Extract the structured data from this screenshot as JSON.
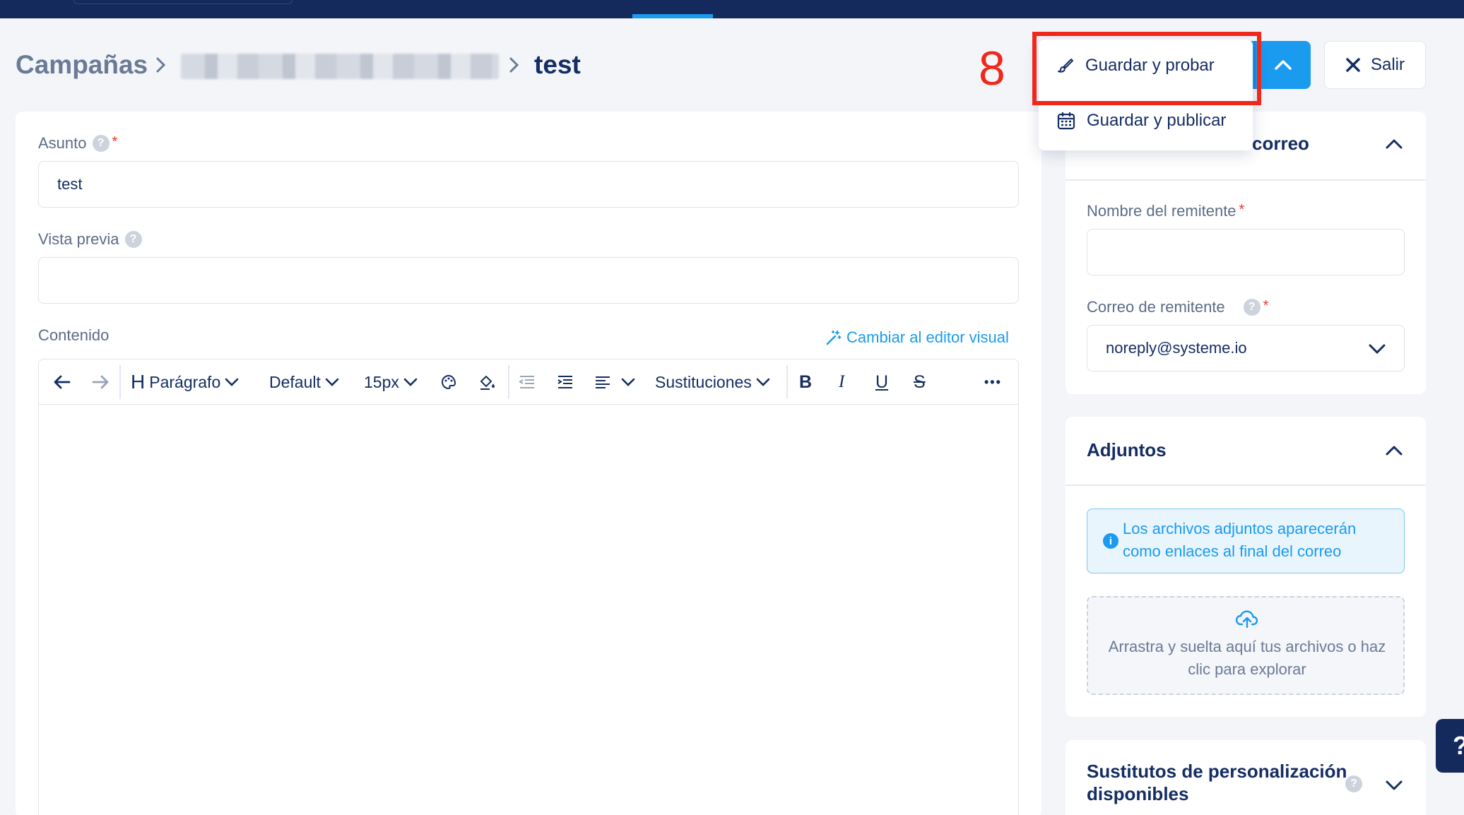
{
  "colors": {
    "accent": "#1a9bf0",
    "navy": "#14295c",
    "highlight": "#f0281c"
  },
  "breadcrumb": {
    "root": "Campañas",
    "separator": ">",
    "current": "test"
  },
  "annotation": {
    "step_number": "8"
  },
  "header": {
    "menu": {
      "save_test_label": "Guardar y probar",
      "save_publish_label": "Guardar y publicar"
    },
    "exit_label": "Salir"
  },
  "form": {
    "subject": {
      "label": "Asunto",
      "required_mark": "*",
      "value": "test"
    },
    "preview": {
      "label": "Vista previa",
      "value": ""
    },
    "content": {
      "label": "Contenido",
      "visual_editor_link": "Cambiar al editor visual"
    }
  },
  "toolbar": {
    "heading_glyph": "H",
    "paragraph": "Parágrafo",
    "font": "Default",
    "size": "15px",
    "bold": "B",
    "italic": "I",
    "underline": "U",
    "strike": "S",
    "substitutions": "Sustituciones",
    "more": "•••"
  },
  "sidebar": {
    "email_settings": {
      "title_suffix": "correo",
      "sender_name": {
        "label": "Nombre del remitente",
        "required_mark": "*",
        "value": ""
      },
      "sender_email": {
        "label": "Correo de remitente",
        "required_mark": "*",
        "value": "noreply@systeme.io"
      }
    },
    "attachments": {
      "title": "Adjuntos",
      "info": "Los archivos adjuntos aparecerán como enlaces al final del correo",
      "dropzone": "Arrastra y suelta aquí tus archivos o haz clic para explorar"
    },
    "substitutions": {
      "title": "Sustitutos de personalización disponibles"
    }
  },
  "help": {
    "glyph": "?"
  }
}
